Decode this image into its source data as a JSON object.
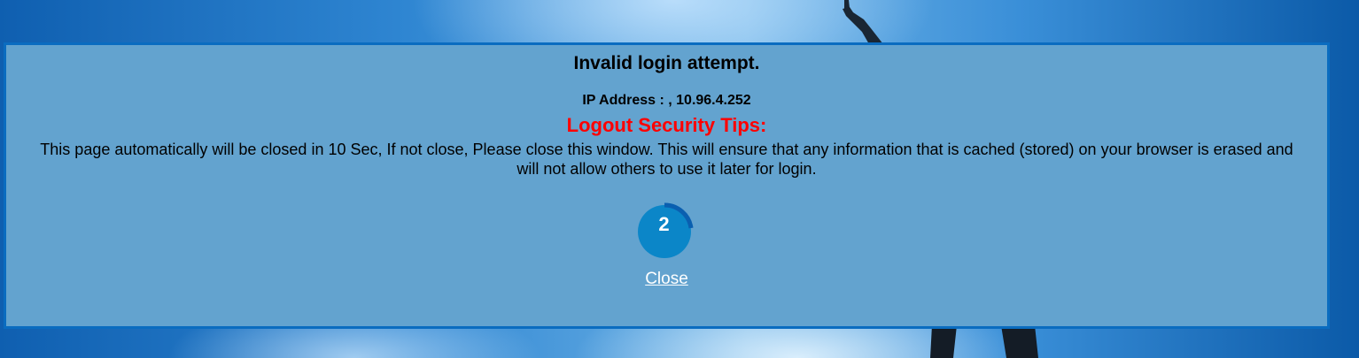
{
  "dialog": {
    "title": "Invalid login attempt.",
    "ip_line": "IP Address : , 10.96.4.252",
    "tips_heading": "Logout Security Tips:",
    "message": "This page automatically will be closed in 10 Sec, If not close, Please close this window. This will ensure that any information that is cached (stored) on your browser is erased and will not allow others to use it later for login.",
    "countdown": "2",
    "close_label": "Close"
  },
  "colors": {
    "dialog_bg": "#63a3cf",
    "dialog_border": "#0a6cc0",
    "tips_heading": "#ff0000",
    "timer_fill": "#0b86c8",
    "timer_arc": "#0a5fb0"
  }
}
